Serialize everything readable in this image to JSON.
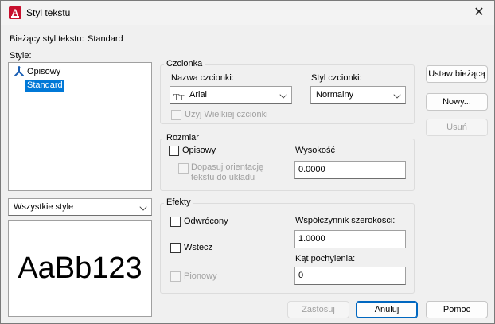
{
  "window": {
    "title": "Styl tekstu",
    "close_glyph": "✕"
  },
  "current_style": {
    "label": "Bieżący styl tekstu:",
    "value": "Standard"
  },
  "styles": {
    "label": "Style:",
    "items": [
      {
        "label": "Opisowy",
        "icon": "annotative-icon"
      },
      {
        "label": "Standard",
        "selected": true
      }
    ],
    "filter_value": "Wszystkie style",
    "preview_text": "AaBb123"
  },
  "font": {
    "group_title": "Czcionka",
    "name_label": "Nazwa czcionki:",
    "name_value": "Arial",
    "style_label": "Styl czcionki:",
    "style_value": "Normalny",
    "big_font_label": "Użyj Wielkiej czcionki"
  },
  "size": {
    "group_title": "Rozmiar",
    "annotative_label": "Opisowy",
    "match_orientation_label_1": "Dopasuj orientację",
    "match_orientation_label_2": "tekstu do układu",
    "height_label": "Wysokość",
    "height_value": "0.0000"
  },
  "effects": {
    "group_title": "Efekty",
    "upside_down_label": "Odwrócony",
    "backwards_label": "Wstecz",
    "vertical_label": "Pionowy",
    "width_factor_label": "Współczynnik szerokości:",
    "width_factor_value": "1.0000",
    "oblique_angle_label": "Kąt pochylenia:",
    "oblique_angle_value": "0"
  },
  "buttons": {
    "set_current": "Ustaw bieżącą",
    "new": "Nowy...",
    "delete": "Usuń",
    "apply": "Zastosuj",
    "cancel": "Anuluj",
    "help": "Pomoc"
  },
  "colors": {
    "selection": "#0078d7",
    "default_button_border": "#0067c0",
    "app_icon": "#c8102e"
  }
}
